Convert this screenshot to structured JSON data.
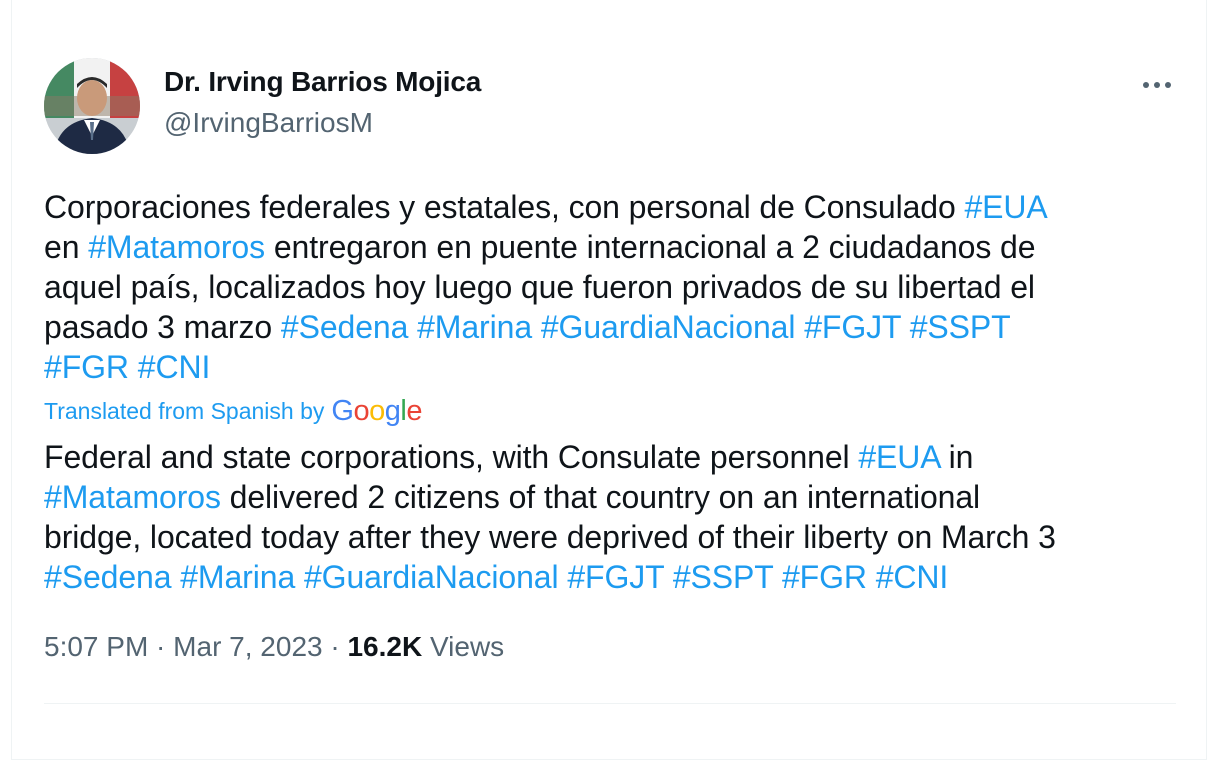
{
  "author": {
    "name": "Dr. Irving Barrios Mojica",
    "handle": "@IrvingBarriosM",
    "avatar_icon": "profile-photo"
  },
  "more_icon": "ellipsis-icon",
  "original_text": [
    [
      {
        "t": "Corporaciones federales y estatales, con personal de Consulado "
      },
      {
        "t": "#EUA",
        "tag": true
      }
    ],
    [
      {
        "t": "en "
      },
      {
        "t": "#Matamoros",
        "tag": true
      },
      {
        "t": " entregaron en puente internacional a 2 ciudadanos de"
      }
    ],
    [
      {
        "t": "aquel país, localizados hoy luego que fueron privados de su libertad el"
      }
    ],
    [
      {
        "t": "pasado 3 marzo "
      },
      {
        "t": "#Sedena",
        "tag": true
      },
      {
        "t": " "
      },
      {
        "t": "#Marina",
        "tag": true
      },
      {
        "t": " "
      },
      {
        "t": "#GuardiaNacional",
        "tag": true
      },
      {
        "t": " "
      },
      {
        "t": "#FGJT",
        "tag": true
      },
      {
        "t": " "
      },
      {
        "t": "#SSPT",
        "tag": true
      }
    ],
    [
      {
        "t": "#FGR",
        "tag": true
      },
      {
        "t": " "
      },
      {
        "t": "#CNI",
        "tag": true
      }
    ]
  ],
  "translation": {
    "label": "Translated from Spanish by",
    "provider": "Google",
    "provider_colors": [
      "#4285F4",
      "#EA4335",
      "#FBBC05",
      "#4285F4",
      "#34A853",
      "#EA4335"
    ]
  },
  "translated_text": [
    [
      {
        "t": "Federal and state corporations, with Consulate personnel "
      },
      {
        "t": "#EUA",
        "tag": true
      },
      {
        "t": " in"
      }
    ],
    [
      {
        "t": "#Matamoros",
        "tag": true
      },
      {
        "t": " delivered 2 citizens of that country on an international"
      }
    ],
    [
      {
        "t": "bridge, located today after they were deprived of their liberty on March 3"
      }
    ],
    [
      {
        "t": "#Sedena",
        "tag": true
      },
      {
        "t": " "
      },
      {
        "t": "#Marina",
        "tag": true
      },
      {
        "t": " "
      },
      {
        "t": "#GuardiaNacional",
        "tag": true
      },
      {
        "t": " "
      },
      {
        "t": "#FGJT",
        "tag": true
      },
      {
        "t": " "
      },
      {
        "t": "#SSPT",
        "tag": true
      },
      {
        "t": " "
      },
      {
        "t": "#FGR",
        "tag": true
      },
      {
        "t": " "
      },
      {
        "t": "#CNI",
        "tag": true
      }
    ]
  ],
  "meta": {
    "time": "5:07 PM",
    "separator": " · ",
    "date": "Mar 7, 2023",
    "views_count": "16.2K",
    "views_label": "Views"
  },
  "colors": {
    "link": "#1d9bf0",
    "text": "#0f1419",
    "secondary": "#536471"
  }
}
